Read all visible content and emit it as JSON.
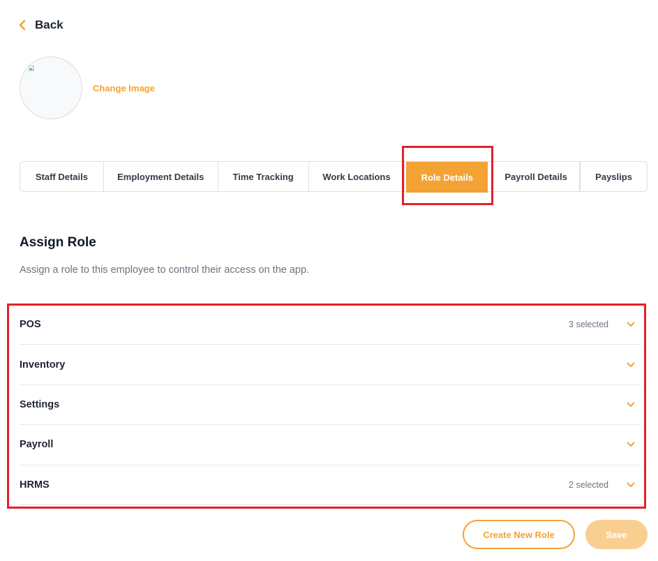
{
  "header": {
    "back_label": "Back",
    "back_icon": "chevron-left-icon"
  },
  "profile": {
    "change_image_label": "Change Image",
    "avatar_icon": "broken-image-icon"
  },
  "tabs": [
    {
      "label": "Staff Details",
      "active": false
    },
    {
      "label": "Employment Details",
      "active": false
    },
    {
      "label": "Time Tracking",
      "active": false
    },
    {
      "label": "Work Locations",
      "active": false
    },
    {
      "label": "Role Details",
      "active": true
    },
    {
      "label": "Payroll Details",
      "active": false
    },
    {
      "label": "Payslips",
      "active": false
    }
  ],
  "section": {
    "title": "Assign Role",
    "description": "Assign a role to this employee to control their access on the app."
  },
  "role_groups": [
    {
      "label": "POS",
      "count": "3 selected"
    },
    {
      "label": "Inventory",
      "count": ""
    },
    {
      "label": "Settings",
      "count": ""
    },
    {
      "label": "Payroll",
      "count": ""
    },
    {
      "label": "HRMS",
      "count": "2 selected"
    }
  ],
  "actions": {
    "create_label": "Create New Role",
    "save_label": "Save"
  },
  "colors": {
    "accent": "#f4a233",
    "save_disabled": "#f9cf91",
    "highlight": "#e3202a"
  }
}
